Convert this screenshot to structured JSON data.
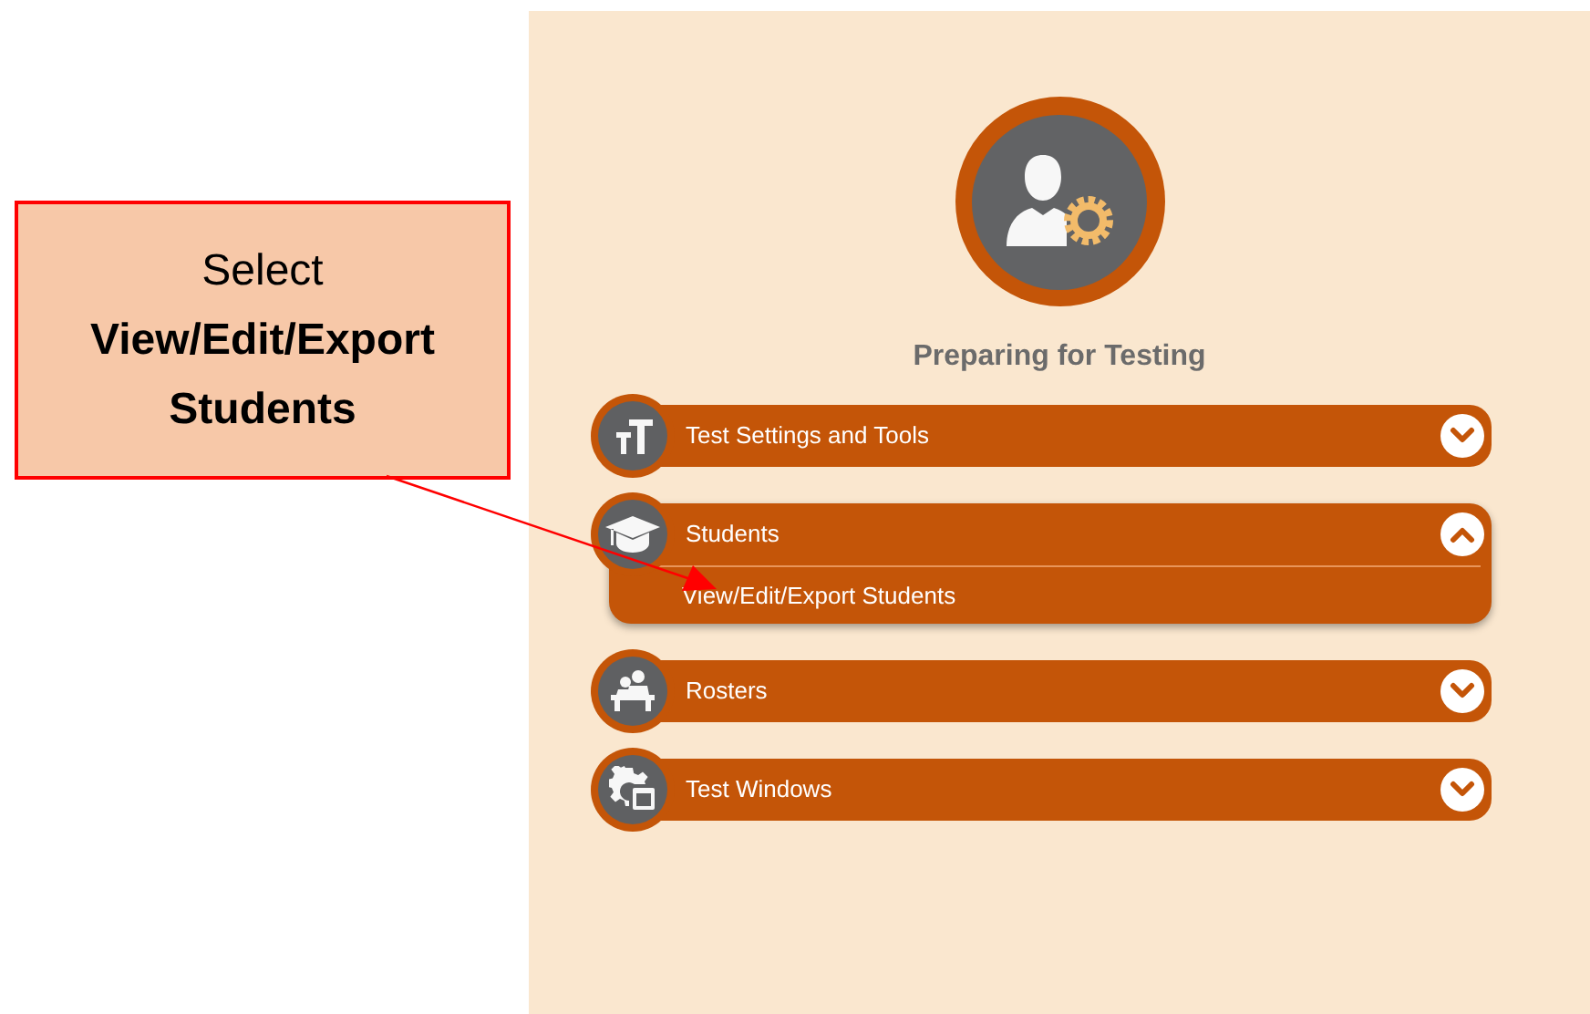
{
  "callout": {
    "text": "Select **View/Edit/Export Students**"
  },
  "panel": {
    "title": "Preparing for Testing"
  },
  "sections": [
    {
      "label": "Test Settings and Tools",
      "expanded": false
    },
    {
      "label": "Students",
      "expanded": true,
      "children": [
        {
          "label": "View/Edit/Export Students"
        }
      ]
    },
    {
      "label": "Rosters",
      "expanded": false
    },
    {
      "label": "Test Windows",
      "expanded": false
    }
  ]
}
